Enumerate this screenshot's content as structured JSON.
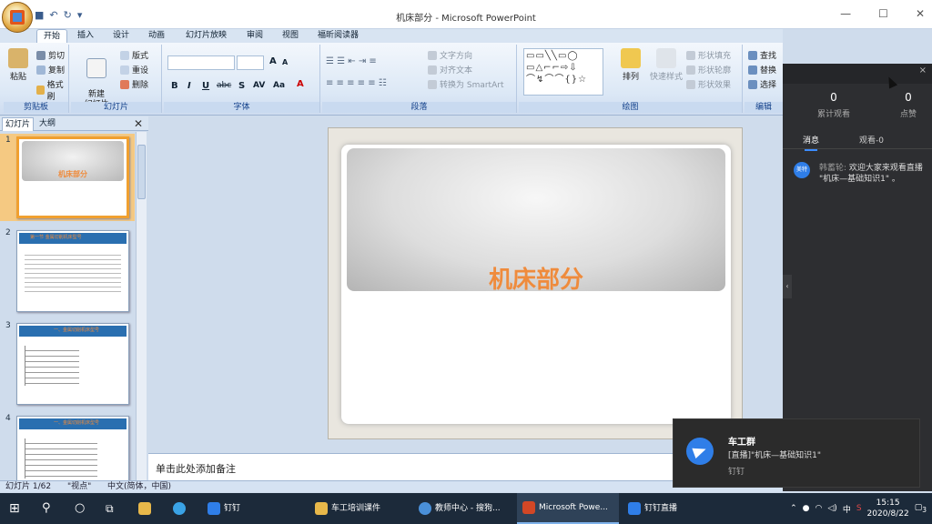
{
  "window": {
    "title": "机床部分 - Microsoft PowerPoint",
    "minimize": "—",
    "maximize": "☐",
    "close": "✕"
  },
  "qat": {
    "save": "■",
    "undo": "↶",
    "redo": "↻",
    "more": "▾"
  },
  "tabs": [
    "开始",
    "插入",
    "设计",
    "动画",
    "幻灯片放映",
    "审阅",
    "视图",
    "福昕阅读器"
  ],
  "ribbon": {
    "clipboard": {
      "label": "剪贴板",
      "paste": "粘贴",
      "cut": "剪切",
      "copy": "复制",
      "painter": "格式刷"
    },
    "slides": {
      "label": "幻灯片",
      "new_slide": "新建\n幻灯片",
      "layout": "版式",
      "reset": "重设",
      "delete": "删除"
    },
    "font": {
      "label": "字体",
      "bold": "B",
      "italic": "I",
      "underline": "U",
      "strike": "abc",
      "shadow": "S",
      "spacing": "AV",
      "case": "Aa",
      "grow": "A",
      "shrink": "A"
    },
    "paragraph": {
      "label": "段落",
      "text_direction": "文字方向",
      "align_text": "对齐文本",
      "smartart": "转换为 SmartArt"
    },
    "drawing": {
      "label": "绘图",
      "arrange": "排列",
      "quick_styles": "快速样式",
      "shape_fill": "形状填充",
      "shape_outline": "形状轮廓",
      "shape_effects": "形状效果"
    },
    "editing": {
      "label": "编辑",
      "find": "查找",
      "replace": "替换",
      "select": "选择"
    }
  },
  "pane": {
    "tab_slides": "幻灯片",
    "tab_outline": "大纲",
    "close": "✕"
  },
  "thumbs": [
    {
      "num": "1",
      "title": "机床部分"
    },
    {
      "num": "2",
      "title": "第一节 金属切削机床型号"
    },
    {
      "num": "3",
      "title": "一、金属切削机床型号"
    },
    {
      "num": "4",
      "title": "一、金属切削机床型号"
    }
  ],
  "slide": {
    "title": "机床部分"
  },
  "notes": {
    "placeholder": "单击此处添加备注"
  },
  "status": {
    "slide_pos": "幻灯片 1/62",
    "theme": "\"视点\"",
    "language": "中文(简体，中国)"
  },
  "live": {
    "close": "×",
    "stats": [
      {
        "value": "0",
        "label": "累计观看"
      },
      {
        "value": "0",
        "label": "点赞"
      }
    ],
    "tabs": [
      "消息",
      "观看-0"
    ],
    "message": {
      "avatar": "美特",
      "sender": "韩蓄轮:",
      "text": "欢迎大家来观看直播 \"机床—基础知识1\" 。"
    }
  },
  "toast": {
    "title": "车工群",
    "body": "[直播]\"机床—基础知识1\"",
    "app": "钉钉"
  },
  "taskbar": {
    "items": [
      {
        "label": "钉钉",
        "color": "#2f7ee8"
      },
      {
        "label": "车工培训课件",
        "color": "#e8b84a"
      },
      {
        "label": "教师中心 - 搜狗...",
        "color": "#4a90d9"
      },
      {
        "label": "Microsoft Powe...",
        "color": "#d24726"
      },
      {
        "label": "钉钉直播",
        "color": "#2f7ee8"
      }
    ],
    "ime": "中",
    "time": "15:15",
    "date": "2020/8/22",
    "notif_count": "3"
  }
}
